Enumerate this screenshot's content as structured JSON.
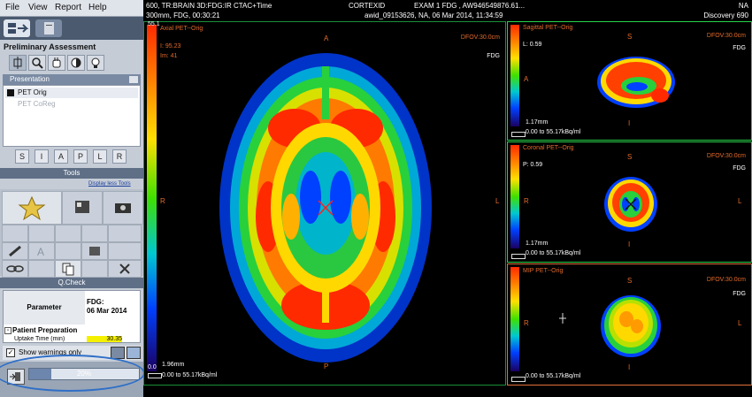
{
  "menu": [
    "File",
    "View",
    "Report",
    "Help"
  ],
  "left_panel": {
    "section_title": "Preliminary Assessment",
    "presentation_title": "Presentation",
    "presentation_items": [
      "PET Orig",
      "PET CoReg"
    ],
    "view_buttons": [
      "S",
      "I",
      "A",
      "P",
      "L",
      "R"
    ],
    "tools_title": "Tools",
    "display_link": "Display less Tools",
    "qcheck_title": "Q.Check",
    "qc_param_header": "Parameter",
    "qc_value_header_line1": "FDG:",
    "qc_value_header_line2": "06 Mar 2014",
    "qc_group": "Patient Preparation",
    "qc_row_label": "Uptake Time (min)",
    "qc_row_value": "30.35",
    "show_warnings": "Show warnings only",
    "progress_label": "20%",
    "progress_value": 0.2
  },
  "header": {
    "line1_left": "600, TR:BRAIN 3D:FDG:IR CTAC+Time",
    "line1_center": "CORTEXID",
    "line1_right": "EXAM 1 FDG , AW946549876.61...",
    "line1_far": "NA",
    "line2_left": "300mm, FDG, 00:30:21",
    "line2_right": "awid_09153626, NA, 06 Mar 2014, 11:34:59",
    "line2_far": "Discovery 690"
  },
  "viewports": {
    "axial": {
      "title": "Axial PET--Orig",
      "line2": "I: 95.23",
      "line3": "Im: 41",
      "dfov": "DFOV:30.0cm",
      "tracer": "FDG",
      "orient_top": "A",
      "orient_left": "R",
      "orient_right": "L",
      "orient_bottom": "P",
      "bar_top": "55.1",
      "bar_bottom": "0.0",
      "thickness": "1.96mm",
      "range": "0.00 to 55.17kBq/ml"
    },
    "sagittal": {
      "title": "Sagittal PET--Orig",
      "line2": "L: 0.59",
      "dfov": "DFOV:30.0cm",
      "tracer": "FDG",
      "orient_top": "S",
      "orient_left": "A",
      "orient_bottom": "I",
      "thickness": "1.17mm",
      "range": "0.00 to 55.17kBq/ml"
    },
    "coronal": {
      "title": "Coronal PET--Orig",
      "line2": "P: 0.59",
      "dfov": "DFOV:30.0cm",
      "tracer": "FDG",
      "orient_top": "S",
      "orient_left": "R",
      "orient_right": "L",
      "orient_bottom": "I",
      "thickness": "1.17mm",
      "range": "0.00 to 55.17kBq/ml"
    },
    "mip": {
      "title": "MIP PET--Orig",
      "dfov": "DFOV:30.0cm",
      "tracer": "FDG",
      "orient_top": "S",
      "orient_left": "R",
      "orient_right": "L",
      "orient_bottom": "I",
      "range": "0.00 to 55.17kBq/ml"
    }
  },
  "colors": {
    "active_border": "#28d24a",
    "mip_border": "#e2703a",
    "overlay_text": "#e46a2a",
    "panel_bg": "#c5ccd6"
  }
}
